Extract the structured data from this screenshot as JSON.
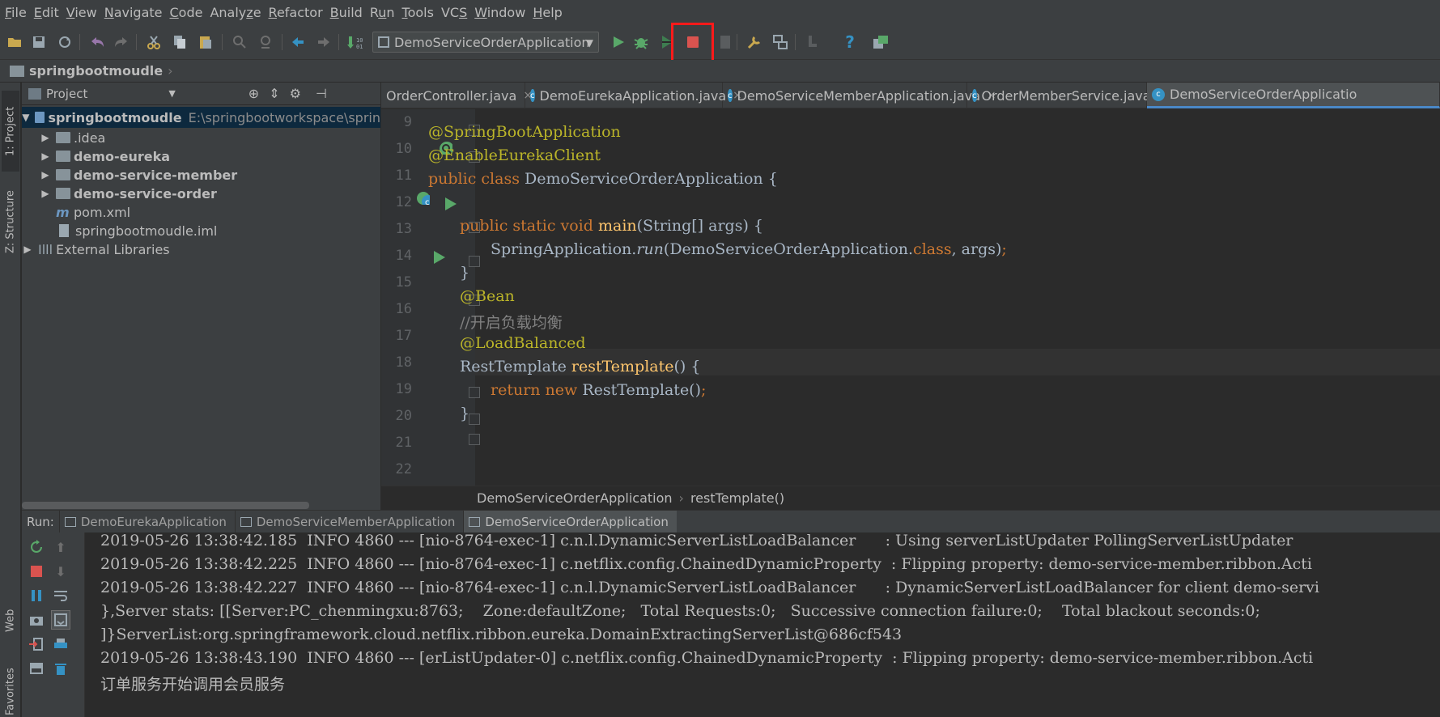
{
  "menu": {
    "items": [
      "File",
      "Edit",
      "View",
      "Navigate",
      "Code",
      "Analyze",
      "Refactor",
      "Build",
      "Run",
      "Tools",
      "VCS",
      "Window",
      "Help"
    ],
    "mnemonics": [
      "F",
      "E",
      "V",
      "N",
      "C",
      "z",
      "R",
      "B",
      "u",
      "T",
      "S",
      "W",
      "H"
    ]
  },
  "toolbar": {
    "run_config": "DemoServiceOrderApplication",
    "icons": [
      "open-icon",
      "save-icon",
      "sync-icon",
      "undo-icon",
      "redo-icon",
      "cut-icon",
      "copy-icon",
      "paste-icon",
      "find-icon",
      "replace-icon",
      "back-icon",
      "forward-icon",
      "build-icon",
      "run-icon",
      "debug-icon",
      "coverage-icon",
      "stop-icon",
      "attach-icon",
      "settings-icon",
      "structure-icon",
      "sdk-icon",
      "help-icon",
      "plugin-icon"
    ],
    "highlight_color": "#ff1a1a"
  },
  "navbar": {
    "project": "springbootmoudle"
  },
  "left_strip": {
    "project_tab": "1: Project",
    "structure_tab": "Z: Structure",
    "web_tab": "Web",
    "favorites_tab": "Favorites"
  },
  "project_panel": {
    "title": "Project",
    "tree": [
      {
        "label": "springbootmoudle",
        "path": "E:\\springbootworkspace\\sprin",
        "bold": true,
        "selected": true
      },
      {
        "label": ".idea",
        "bold": false
      },
      {
        "label": "demo-eureka",
        "bold": true
      },
      {
        "label": "demo-service-member",
        "bold": true
      },
      {
        "label": "demo-service-order",
        "bold": true
      },
      {
        "label": "pom.xml",
        "bold": false
      },
      {
        "label": "springbootmoudle.iml",
        "bold": false
      },
      {
        "label": "External Libraries",
        "bold": false
      }
    ]
  },
  "editor_tabs": [
    {
      "label": "OrderController.java",
      "active": false
    },
    {
      "label": "DemoEurekaApplication.java",
      "active": false
    },
    {
      "label": "DemoServiceMemberApplication.java",
      "active": false
    },
    {
      "label": "OrderMemberService.java",
      "active": false
    },
    {
      "label": "DemoServiceOrderApplicatio",
      "active": true
    }
  ],
  "editor": {
    "line_numbers": [
      "9",
      "10",
      "11",
      "12",
      "13",
      "14",
      "15",
      "16",
      "17",
      "18",
      "19",
      "20",
      "21",
      "22"
    ],
    "code": {
      "l10": "@SpringBootApplication",
      "l11": "@EnableEurekaClient",
      "l12_kw": "public class ",
      "l12_rest": "DemoServiceOrderApplication {",
      "l14_kw": "public static void ",
      "l14_fn": "main",
      "l14_rest": "(String[] args) {",
      "l15_a": "SpringApplication.",
      "l15_run": "run",
      "l15_b": "(DemoServiceOrderApplication.",
      "l15_class": "class",
      "l15_c": ", args)",
      "l15_semi": ";",
      "l16": "}",
      "l17": "@Bean",
      "l18": "//开启负载均衡",
      "l19": "@LoadBalanced",
      "l20_a": "RestTemplate ",
      "l20_fn": "restTemplate",
      "l20_b": "() {",
      "l21_kw": "return new ",
      "l21_rest": "RestTemplate()",
      "l21_semi": ";",
      "l22": "}"
    },
    "breadcrumb": [
      "DemoServiceOrderApplication",
      "restTemplate()"
    ]
  },
  "run_panel": {
    "label": "Run:",
    "tabs": [
      "DemoEurekaApplication",
      "DemoServiceMemberApplication",
      "DemoServiceOrderApplication"
    ],
    "active_tab": 2
  },
  "console": {
    "lines": [
      "2019-05-26 13:38:42.185  INFO 4860 --- [nio-8764-exec-1] c.n.l.DynamicServerListLoadBalancer      : Using serverListUpdater PollingServerListUpdater",
      "2019-05-26 13:38:42.225  INFO 4860 --- [nio-8764-exec-1] c.netflix.config.ChainedDynamicProperty  : Flipping property: demo-service-member.ribbon.Acti",
      "2019-05-26 13:38:42.227  INFO 4860 --- [nio-8764-exec-1] c.n.l.DynamicServerListLoadBalancer      : DynamicServerListLoadBalancer for client demo-servi",
      "},Server stats: [[Server:PC_chenmingxu:8763;    Zone:defaultZone;   Total Requests:0;   Successive connection failure:0;    Total blackout seconds:0;",
      "]}ServerList:org.springframework.cloud.netflix.ribbon.eureka.DomainExtractingServerList@686cf543",
      "2019-05-26 13:38:43.190  INFO 4860 --- [erListUpdater-0] c.netflix.config.ChainedDynamicProperty  : Flipping property: demo-service-member.ribbon.Acti",
      "订单服务开始调用会员服务"
    ]
  }
}
